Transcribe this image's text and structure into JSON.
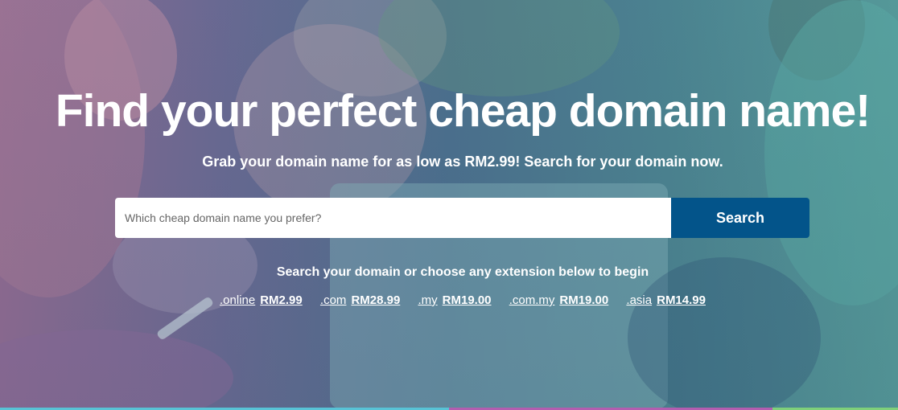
{
  "hero": {
    "title": "Find your perfect cheap domain name!",
    "subtitle": "Grab your domain name for as low as RM2.99! Search for your domain now."
  },
  "search": {
    "placeholder": "Which cheap domain name you prefer?",
    "value": "",
    "button_label": "Search"
  },
  "hint": "Search your domain or choose any extension below to begin",
  "extensions": [
    {
      "name": ".online",
      "price": "RM2.99"
    },
    {
      "name": ".com",
      "price": "RM28.99"
    },
    {
      "name": ".my",
      "price": "RM19.00"
    },
    {
      "name": ".com.my",
      "price": "RM19.00"
    },
    {
      "name": ".asia",
      "price": "RM14.99"
    }
  ],
  "colors": {
    "search_button": "#03548a",
    "overlay_left": "#9b7198",
    "overlay_right": "#5aa4a0"
  }
}
